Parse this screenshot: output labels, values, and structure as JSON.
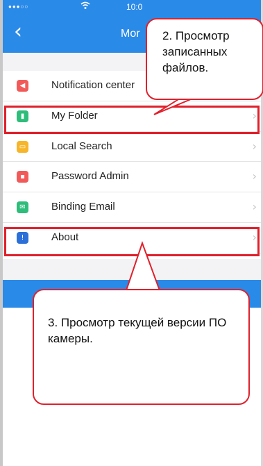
{
  "status_bar": {
    "signal": "●●●○○",
    "time": "10:0"
  },
  "nav": {
    "title": "Mor"
  },
  "menu": [
    {
      "label": "Notification center",
      "icon": "bell-icon",
      "color": "#f25a5a",
      "glyph": "◀"
    },
    {
      "label": "My Folder",
      "icon": "folder-icon",
      "color": "#2ebd7a",
      "glyph": "▮"
    },
    {
      "label": "Local Search",
      "icon": "search-icon",
      "color": "#f7b52a",
      "glyph": "▭"
    },
    {
      "label": "Password Admin",
      "icon": "lock-icon",
      "color": "#f25a5a",
      "glyph": "▪"
    },
    {
      "label": "Binding Email",
      "icon": "email-icon",
      "color": "#2ebd7a",
      "glyph": "✉"
    },
    {
      "label": "About",
      "icon": "info-icon",
      "color": "#2c6fd8",
      "glyph": "!"
    }
  ],
  "callouts": {
    "folder": "2. Просмотр записанных файлов.",
    "about": "3. Просмотр текущей версии ПО камеры."
  },
  "colors": {
    "accent": "#2a8ae8",
    "highlight": "#e0202b"
  }
}
